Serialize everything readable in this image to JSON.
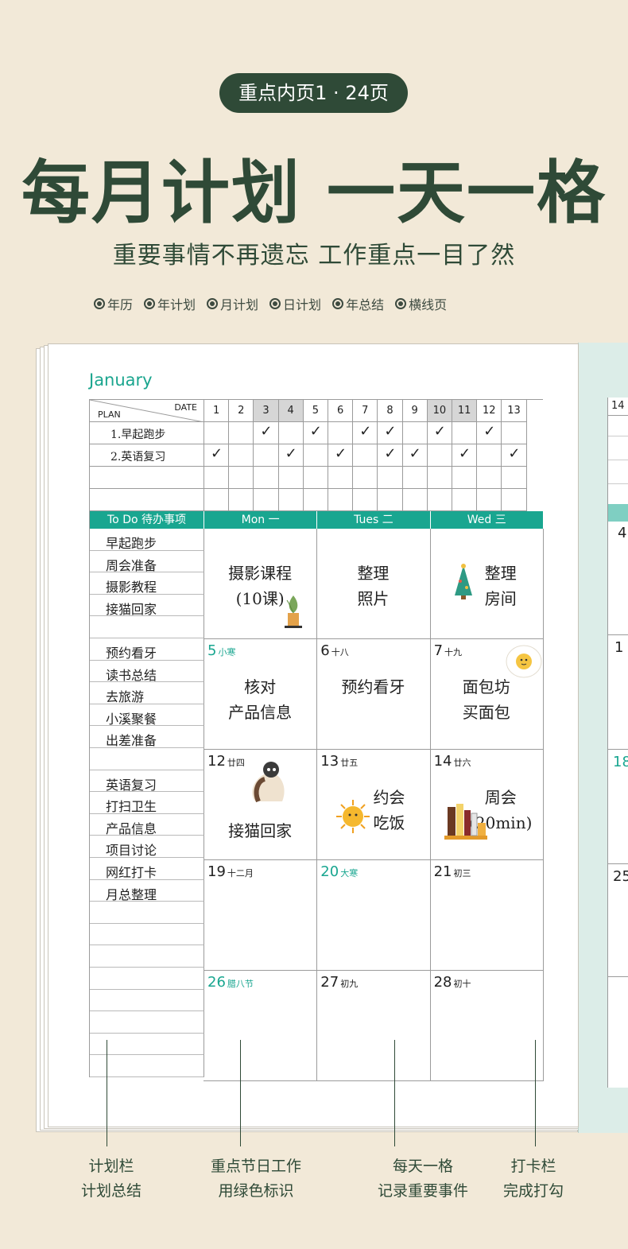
{
  "badge": "重点内页1 · 24页",
  "title": "每月计划 一天一格",
  "subtitle": "重要事情不再遗忘  工作重点一目了然",
  "features": [
    "年历",
    "年计划",
    "月计划",
    "日计划",
    "年总结",
    "横线页"
  ],
  "planner": {
    "month": "January",
    "header_plan": "PLAN",
    "header_date": "DATE",
    "dates": [
      "1",
      "2",
      "3",
      "4",
      "5",
      "6",
      "7",
      "8",
      "9",
      "10",
      "11",
      "12",
      "13"
    ],
    "right_date": "14",
    "plans": [
      "1.早起跑步",
      "2.英语复习"
    ],
    "todo_header": "To Do  待办事项",
    "weekdays": [
      "Mon  一",
      "Tues  二",
      "Wed 三"
    ],
    "todo_items": [
      "早起跑步",
      "周会准备",
      "摄影教程",
      "接猫回家",
      "",
      "预约看牙",
      "读书总结",
      "去旅游",
      "小溪聚餐",
      "出差准备",
      "",
      "英语复习",
      "打扫卫生",
      "产品信息",
      "项目讨论",
      "网红打卡",
      "月总整理"
    ],
    "weeks": [
      [
        {
          "day": "",
          "lunar": "",
          "note": "摄影课程\n(10课)"
        },
        {
          "day": "",
          "lunar": "",
          "note": "整理\n照片"
        },
        {
          "day": "",
          "lunar": "",
          "note": "整理\n房间"
        }
      ],
      [
        {
          "day": "5",
          "lunar": "小寒",
          "note": "核对\n产品信息"
        },
        {
          "day": "6",
          "lunar": "十八",
          "note": "预约看牙"
        },
        {
          "day": "7",
          "lunar": "十九",
          "note": "面包坊\n买面包"
        }
      ],
      [
        {
          "day": "12",
          "lunar": "廿四",
          "note": "接猫回家"
        },
        {
          "day": "13",
          "lunar": "廿五",
          "note": "约会\n吃饭"
        },
        {
          "day": "14",
          "lunar": "廿六",
          "note": "周会\n(20min)"
        }
      ],
      [
        {
          "day": "19",
          "lunar": "十二月",
          "note": ""
        },
        {
          "day": "20",
          "lunar": "大寒",
          "note": ""
        },
        {
          "day": "21",
          "lunar": "初三",
          "note": ""
        }
      ],
      [
        {
          "day": "26",
          "lunar": "腊八节",
          "note": ""
        },
        {
          "day": "27",
          "lunar": "初九",
          "note": ""
        },
        {
          "day": "28",
          "lunar": "初十",
          "note": ""
        }
      ]
    ],
    "right_peek": [
      "4",
      "1",
      "18",
      "25"
    ]
  },
  "callouts": [
    {
      "line1": "计划栏",
      "line2": "计划总结"
    },
    {
      "line1": "重点节日工作",
      "line2": "用绿色标识"
    },
    {
      "line1": "每天一格",
      "line2": "记录重要事件"
    },
    {
      "line1": "打卡栏",
      "line2": "完成打勾"
    }
  ],
  "colors": {
    "accent": "#19a690",
    "dark": "#2f4a37",
    "background": "#f2e9d8"
  }
}
